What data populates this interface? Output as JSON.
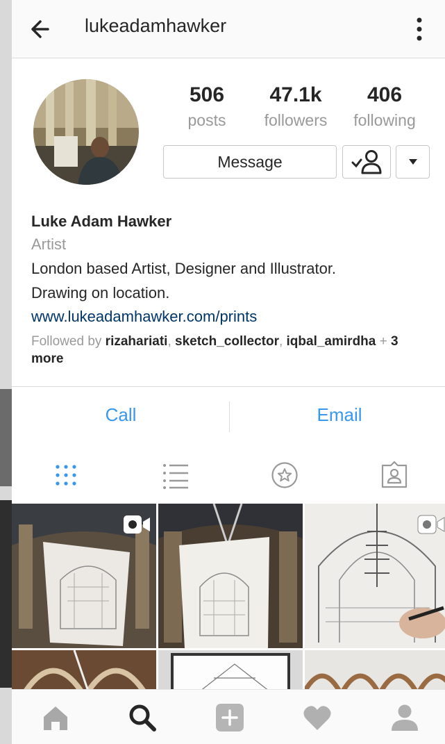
{
  "header": {
    "username": "lukeadamhawker",
    "back_icon": "arrow-left-icon",
    "more_icon": "more-vertical-icon"
  },
  "stats": [
    {
      "value": "506",
      "label": "posts"
    },
    {
      "value": "47.1k",
      "label": "followers"
    },
    {
      "value": "406",
      "label": "following"
    }
  ],
  "actions": {
    "message_label": "Message",
    "following_icon": "person-check-icon",
    "dropdown_icon": "caret-down-icon"
  },
  "bio": {
    "name": "Luke Adam Hawker",
    "category": "Artist",
    "line1": "London based Artist, Designer and Illustrator.",
    "line2": "Drawing on location.",
    "link": "www.lukeadamhawker.com/prints"
  },
  "followed_by": {
    "prefix": "Followed by ",
    "users": [
      "rizahariati",
      "sketch_collector",
      "iqbal_amirdha"
    ],
    "separator": ", ",
    "suffix_plus": " + ",
    "suffix_count": "3",
    "suffix_more": "more"
  },
  "contact": {
    "call_label": "Call",
    "email_label": "Email"
  },
  "view_tabs": [
    "grid-view-icon",
    "list-view-icon",
    "saved-star-icon",
    "tagged-photos-icon"
  ],
  "posts": [
    {
      "type": "video",
      "subject": "sketch held up in museum hall"
    },
    {
      "type": "photo",
      "subject": "sketch held in front of whale skeleton"
    },
    {
      "type": "video",
      "subject": "hand drawing museum hall sketch"
    },
    {
      "type": "photo",
      "subject": "whale skeleton in hall"
    },
    {
      "type": "photo",
      "subject": "sketchbook drawing"
    },
    {
      "type": "photo",
      "subject": "museum arches"
    }
  ],
  "bottom_nav": [
    "home-icon",
    "search-icon",
    "add-post-icon",
    "activity-heart-icon",
    "profile-icon"
  ],
  "colors": {
    "link_blue": "#3897f0",
    "bio_link": "#003569",
    "muted": "#999999"
  }
}
